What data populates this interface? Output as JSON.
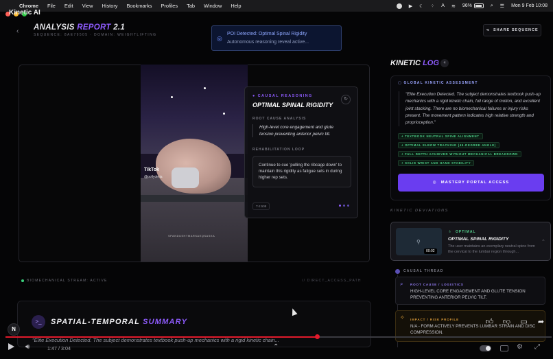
{
  "menubar": {
    "app": "Chrome",
    "items": [
      "File",
      "Edit",
      "View",
      "History",
      "Bookmarks",
      "Profiles",
      "Tab",
      "Window",
      "Help"
    ],
    "battery": "96%",
    "datetime": "Mon 9 Feb  10:08"
  },
  "app": {
    "title": "Kinetic AI"
  },
  "header": {
    "title_main": "ANALYSIS",
    "title_accent": "REPORT",
    "title_version": "2.1",
    "subtitle": "SEQUENCE: 8AE79505 · DOMAIN: WEIGHTLIFTING",
    "share_label": "SHARE SEQUENCE"
  },
  "poi": {
    "line1": "POI Detected: Optimal Spinal Rigidity",
    "line2": "Autonomous reasoning reveal active..."
  },
  "video": {
    "tiktok": "TikTok",
    "tiktok_user": "@pollyderia",
    "watermark": "SPANDUSHTMARSAEQSASKA"
  },
  "causal": {
    "eyebrow": "CAUSAL REASONING",
    "title": "OPTIMAL SPINAL RIGIDITY",
    "root_label": "ROOT CAUSE ANALYSIS",
    "root_text": "High-level core engagement and glute tension preventing anterior pelvic tilt.",
    "rehab_label": "REHABILITATION LOOP",
    "rehab_text": "Continue to cue 'pulling the ribcage down' to maintain this rigidity as fatigue sets in during higher rep sets.",
    "timestamp": "T-2.508"
  },
  "stream": {
    "status": "BIOMECHANICAL STREAM: ACTIVE",
    "path": "// DIRECT_ACCESS_PATH"
  },
  "summary": {
    "title_main": "SPATIAL-TEMPORAL",
    "title_accent": "SUMMARY",
    "quote": "\"Elite Execution Detected. The subject demonstrates textbook push-up mechanics with a rigid kinetic chain..."
  },
  "log": {
    "title_main": "KINETIC",
    "title_accent": "LOG",
    "count": "4",
    "assessment_label": "GLOBAL KINETIC ASSESSMENT",
    "assessment_text": "\"Elite Execution Detected. The subject demonstrates textbook push-up mechanics with a rigid kinetic chain, full range of motion, and excellent joint stacking. There are no biomechanical failures or injury risks present. The movement pattern indicates high relative strength and proprioception.\"",
    "tags": [
      "+ TEXTBOOK NEUTRAL SPINE ALIGNMENT",
      "+ OPTIMAL ELBOW TRACKING (45-DEGREE ANGLE)",
      "+ FULL DEPTH ACHIEVED WITHOUT MECHANICAL BREAKDOWN",
      "+ SOLID WRIST AND HAND STABILITY"
    ],
    "mastery_label": "MASTERY PORTAL ACCESS"
  },
  "deviations": {
    "label": "KINETIC DEVIATIONS",
    "card": {
      "tag": "OPTIMAL",
      "title": "OPTIMAL SPINAL RIGIDITY",
      "desc": "The user maintains an exemplary neutral spine from the cervical to the lumbar region through...",
      "time": "00:02"
    }
  },
  "thread": {
    "label": "CAUSAL THREAD",
    "root_tag": "ROOT CAUSE / LOGISTICS",
    "root_text": "HIGH-LEVEL CORE ENGAGEMENT AND GLUTE TENSION PREVENTING ANTERIOR PELVIC TILT.",
    "impact_tag": "IMPACT / RISK PROFILE",
    "impact_text": "N/A - FORM ACTIVELY PREVENTS LUMBAR STRAIN AND DISC COMPRESSION."
  },
  "player": {
    "time": "1:47 / 3:04",
    "progress": 0.57,
    "badge": "N"
  },
  "colors": {
    "accent": "#8f5cff",
    "success": "#4fd58d",
    "warning": "#d99a3a",
    "progress": "#e21a2c"
  }
}
